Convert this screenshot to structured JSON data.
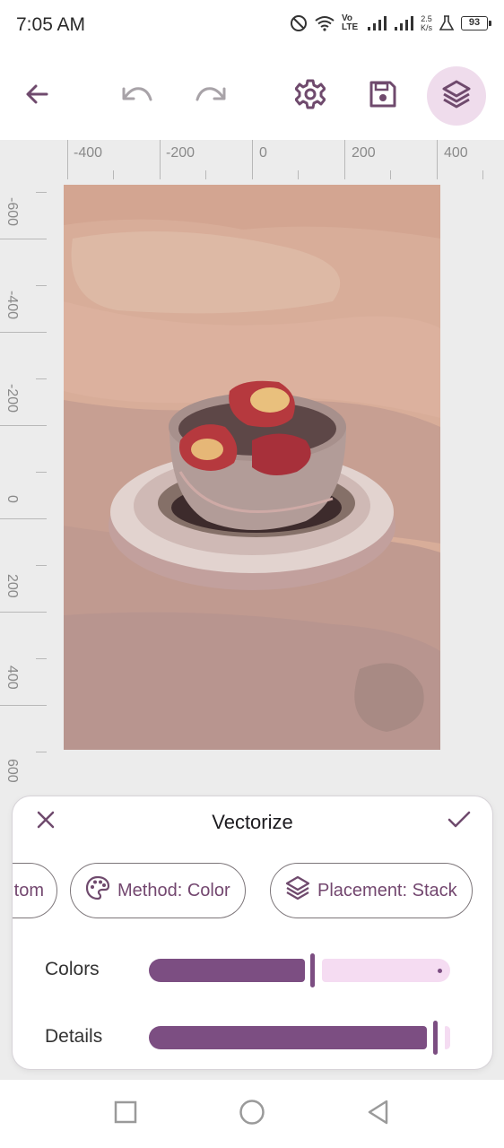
{
  "status_bar": {
    "time": "7:05 AM",
    "network_type": "Vo LTE",
    "speed_value": "2.5",
    "speed_unit": "K/s",
    "battery": "93",
    "icons": [
      "do-not-disturb-icon",
      "wifi-icon",
      "signal-icon",
      "signal-icon",
      "flask-icon",
      "battery-icon"
    ]
  },
  "toolbar": {
    "icons": [
      "back-arrow-icon",
      "undo-icon",
      "redo-icon",
      "settings-icon",
      "save-icon",
      "layers-icon"
    ],
    "active_icon": "layers-icon"
  },
  "rulers": {
    "horizontal": [
      "-400",
      "-200",
      "0",
      "200",
      "400"
    ],
    "vertical": [
      "-600",
      "-400",
      "-200",
      "0",
      "200",
      "400",
      "600"
    ]
  },
  "vectorize_sheet": {
    "title": "Vectorize",
    "chips": [
      {
        "label": "tom",
        "icon": null
      },
      {
        "label": "Method: Color",
        "icon": "palette-icon"
      },
      {
        "label": "Placement: Stack",
        "icon": "layers-icon"
      }
    ],
    "sliders": [
      {
        "label": "Colors",
        "fraction": 0.54
      },
      {
        "label": "Details",
        "fraction": 0.96
      }
    ]
  },
  "colors": {
    "accent": "#7c4e82",
    "accent_light": "#f5dcf2",
    "active_bg": "#efdcec",
    "canvas_bg": "#ececec"
  },
  "nav_bar": {
    "icons": [
      "recents-square-icon",
      "home-circle-icon",
      "back-triangle-icon"
    ]
  }
}
